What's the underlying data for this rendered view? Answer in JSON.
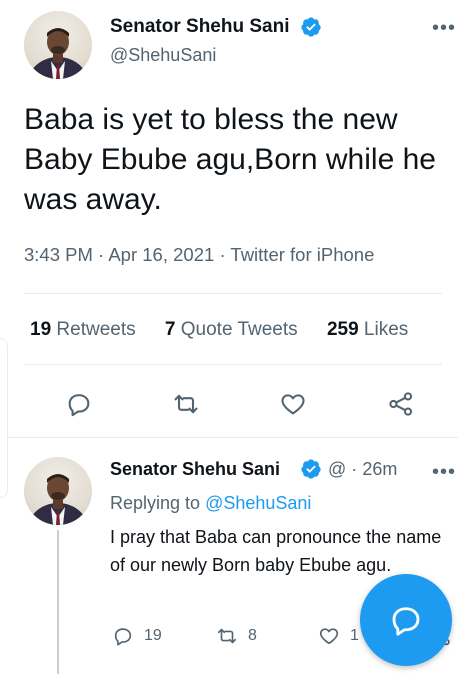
{
  "tweet": {
    "author_name": "Senator Shehu Sani",
    "author_handle": "@ShehuSani",
    "text": "Baba is yet to bless the new Baby Ebube agu,Born while he was away.",
    "time": "3:43 PM",
    "date": "Apr 16, 2021",
    "source": "Twitter for iPhone",
    "separator": "·",
    "stats": {
      "retweets_count": "19",
      "retweets_label": "Retweets",
      "quotes_count": "7",
      "quotes_label": "Quote Tweets",
      "likes_count": "259",
      "likes_label": "Likes"
    }
  },
  "reply": {
    "author_name": "Senator Shehu Sani",
    "author_handle": "@",
    "separator": "·",
    "time": "26m",
    "replying_prefix": "Replying to",
    "replying_mention": "@ShehuSani",
    "text": "I pray that Baba can pronounce the name of our newly Born baby Ebube agu.",
    "reply_count": "19",
    "retweet_count": "8",
    "like_count": "1"
  },
  "icons": {
    "verified": "verified-badge-icon",
    "more": "more-options-icon",
    "reply": "reply-icon",
    "retweet": "retweet-icon",
    "like": "heart-icon",
    "share": "share-icon",
    "compose": "compose-icon"
  },
  "colors": {
    "accent": "#1d9bf0",
    "text_primary": "#0f1419",
    "text_secondary": "#536471",
    "divider": "#e6ecf0"
  }
}
